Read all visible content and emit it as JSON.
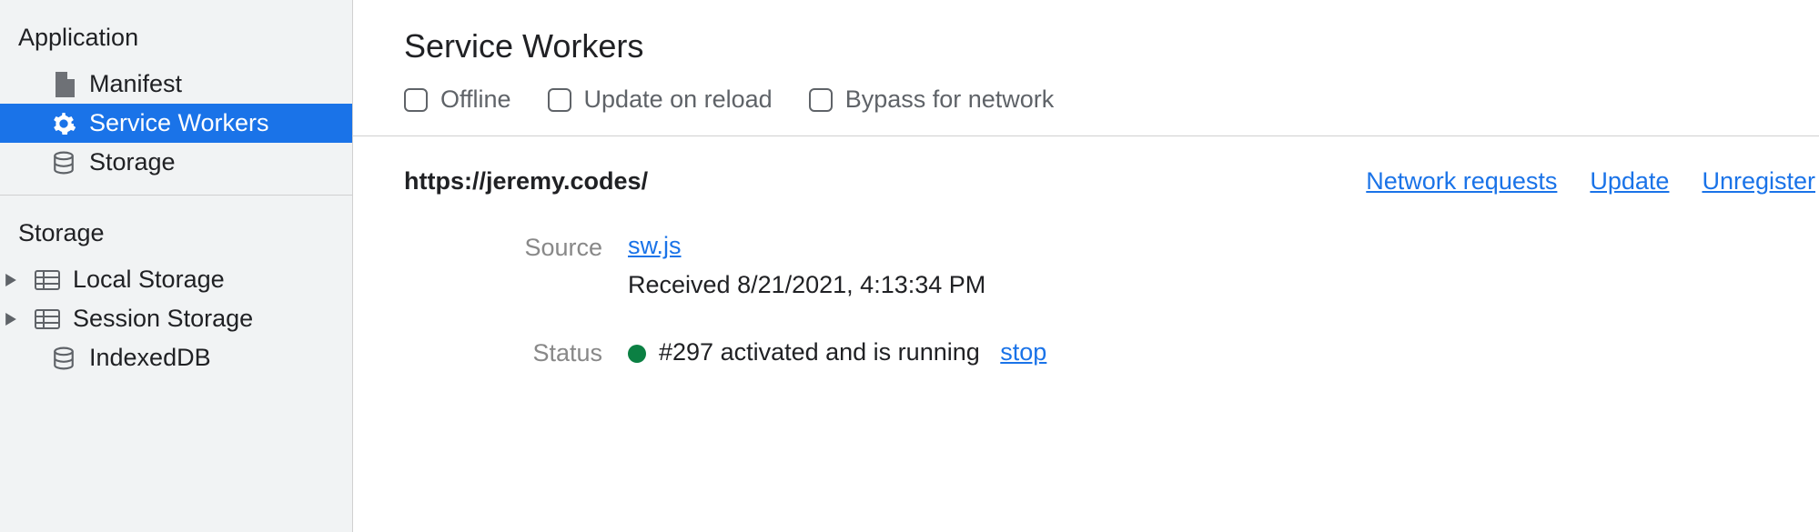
{
  "sidebar": {
    "section1": "Application",
    "items1": [
      {
        "label": "Manifest"
      },
      {
        "label": "Service Workers"
      },
      {
        "label": "Storage"
      }
    ],
    "section2": "Storage",
    "items2": [
      {
        "label": "Local Storage"
      },
      {
        "label": "Session Storage"
      },
      {
        "label": "IndexedDB"
      }
    ]
  },
  "main": {
    "title": "Service Workers",
    "checkboxes": {
      "offline": "Offline",
      "updateReload": "Update on reload",
      "bypass": "Bypass for network"
    },
    "origin": "https://jeremy.codes/",
    "links": {
      "network": "Network requests",
      "update": "Update",
      "unregister": "Unregister"
    },
    "details": {
      "sourceLabel": "Source",
      "sourceFile": "sw.js",
      "received": "Received 8/21/2021, 4:13:34 PM",
      "statusLabel": "Status",
      "statusText": "#297 activated and is running",
      "stop": "stop"
    }
  }
}
